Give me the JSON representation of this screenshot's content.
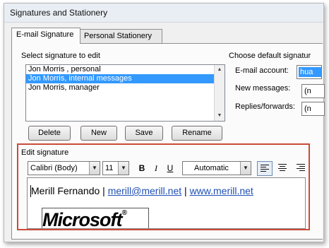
{
  "window": {
    "title": "Signatures and Stationery"
  },
  "tabs": [
    {
      "label": "E-mail Signature",
      "active": true
    },
    {
      "label": "Personal Stationery",
      "active": false
    }
  ],
  "select_signature": {
    "label": "Select signature to edit",
    "items": [
      {
        "label": "Jon Morris , personal",
        "selected": false
      },
      {
        "label": "Jon Morris, internal messages",
        "selected": true
      },
      {
        "label": "Jon Morris, manager",
        "selected": false
      }
    ]
  },
  "buttons": {
    "delete": "Delete",
    "new": "New",
    "save": "Save",
    "rename": "Rename"
  },
  "default_signature": {
    "label": "Choose default signatur",
    "email_account_label": "E-mail account:",
    "email_account_value": "hua",
    "new_messages_label": "New messages:",
    "new_messages_value": "(n",
    "replies_label": "Replies/forwards:",
    "replies_value": "(n"
  },
  "edit_signature": {
    "label": "Edit signature",
    "font": "Calibri (Body)",
    "size": "11",
    "bold": "B",
    "italic": "I",
    "underline": "U",
    "color": "Automatic",
    "highlight_color": "#cc4b37",
    "signature": {
      "name": "Merill Fernando",
      "sep1": "|",
      "email": "merill@merill.net",
      "sep2": "|",
      "website": "www.merill.net"
    },
    "logo_text": "Microsoft",
    "logo_mark": "®"
  },
  "colors": {
    "selection": "#3399ff",
    "link": "#1f4fb4"
  }
}
